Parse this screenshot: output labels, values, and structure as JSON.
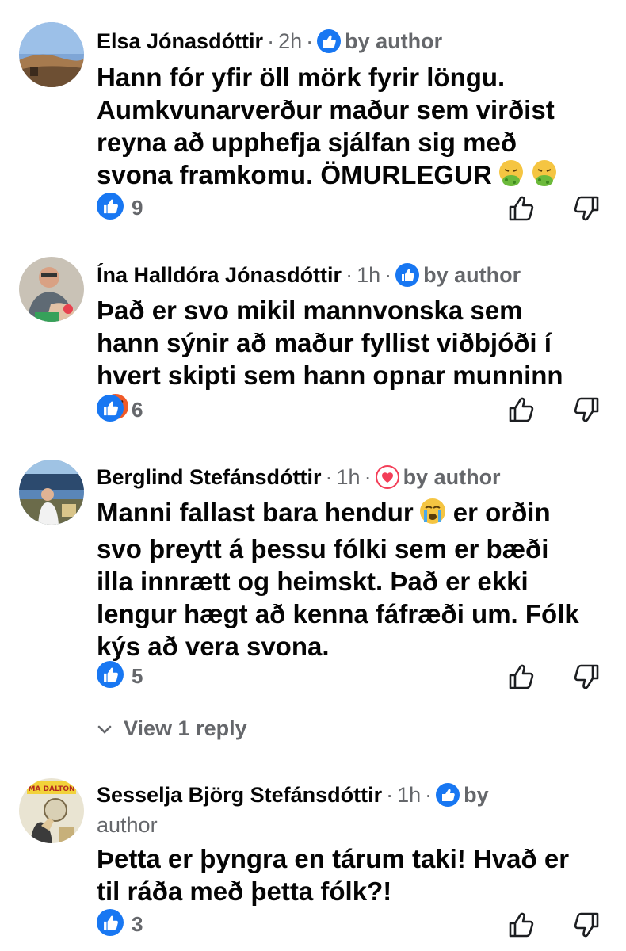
{
  "comments": [
    {
      "name": "Elsa Jónasdóttir",
      "time": "2h",
      "reaction": "like",
      "by_author": "by author",
      "text": "Hann fór yfir öll mörk fyrir löngu. Aumkvunarverður maður sem virðist reyna að upphefja sjálfan sig með svona framkomu. ÖMURLEGUR",
      "emoji": "nauseated-face-x2",
      "likes": "9"
    },
    {
      "name": "Ína Halldóra Jónasdóttir",
      "time": "1h",
      "reaction": "like",
      "by_author": "by author",
      "text": "Það er svo mikil mannvonska sem hann sýnir að maður fyllist viðbjóði í hvert skipti sem hann opnar munninn",
      "emoji": "angry-face",
      "likes": "6"
    },
    {
      "name": "Berglind Stefánsdóttir",
      "time": "1h",
      "reaction": "love",
      "by_author": "by author",
      "text_before_emoji": "Manni fallast bara hendur",
      "text_after_emoji": "er orðin svo þreytt á þessu fólki sem er bæði illa innrætt og heimskt. Það er ekki lengur hægt að kenna fáfræði um. Fólk kýs að vera svona.",
      "emoji": "loudly-crying-face",
      "likes": "5",
      "view_replies": "View 1 reply"
    },
    {
      "name": "Sesselja Björg Stefánsdóttir",
      "time": "1h",
      "reaction": "like",
      "by_author_line1": "by",
      "by_author_line2": "author",
      "text": "Þetta er þyngra en tárum taki! Hvað er til ráða með þetta fólk?!",
      "likes": "3"
    }
  ],
  "colors": {
    "like_blue": "#1877f2",
    "love_red": "#f33e58",
    "meta_gray": "#65676b",
    "text": "#050505"
  }
}
